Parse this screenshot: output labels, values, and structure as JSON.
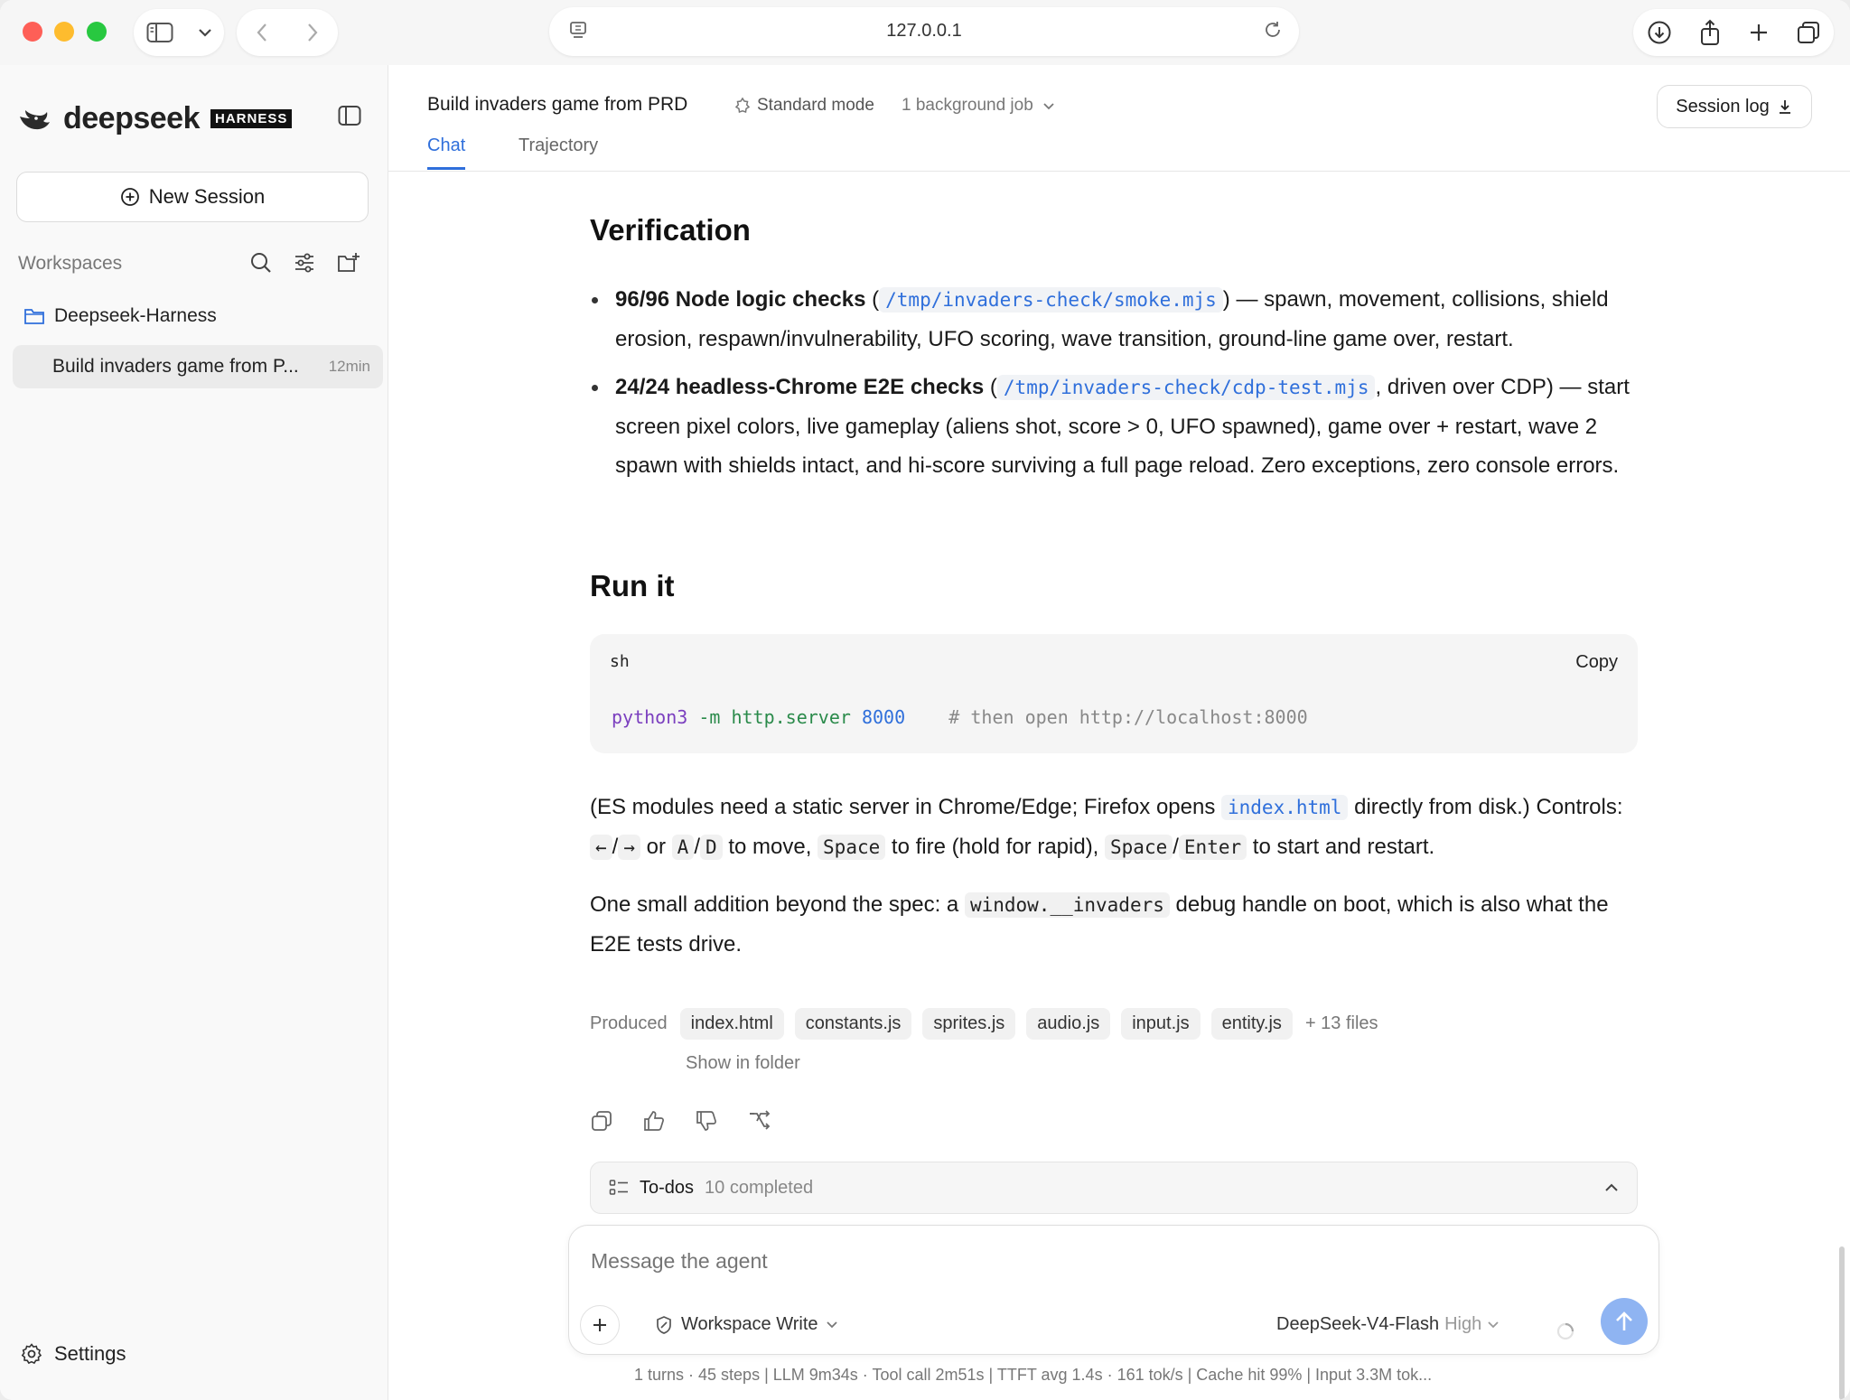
{
  "browser": {
    "url": "127.0.0.1"
  },
  "sidebar": {
    "brand_name": "deepseek",
    "brand_badge": "HARNESS",
    "new_session_label": "New Session",
    "workspaces_label": "Workspaces",
    "workspace_name": "Deepseek-Harness",
    "session_title": "Build invaders game from P...",
    "session_time": "12min",
    "settings_label": "Settings"
  },
  "header": {
    "session_name": "Build invaders game from PRD",
    "mode": "Standard mode",
    "background_jobs": "1 background job",
    "session_log_label": "Session log",
    "tabs": [
      {
        "label": "Chat",
        "active": true
      },
      {
        "label": "Trajectory",
        "active": false
      }
    ]
  },
  "content": {
    "verification_heading": "Verification",
    "bullet1": {
      "bold": "96/96 Node logic checks",
      "open": " (",
      "code": "/tmp/invaders-check/smoke.mjs",
      "rest": ") — spawn, movement, collisions, shield erosion, respawn/invulnerability, UFO scoring, wave transition, ground-line game over, restart."
    },
    "bullet2": {
      "bold": "24/24 headless-Chrome E2E checks",
      "open": " (",
      "code": "/tmp/invaders-check/cdp-test.mjs",
      "rest": ", driven over CDP) — start screen pixel colors, live gameplay (aliens shot, score > 0, UFO spawned), game over + restart, wave 2 spawn with shields intact, and hi-score surviving a full page reload. Zero exceptions, zero console errors."
    },
    "run_heading": "Run it",
    "code_block": {
      "lang": "sh",
      "copy_label": "Copy",
      "cmd": "python3",
      "flag": " -m http.server",
      "num": " 8000",
      "comment": "    # then open http://localhost:8000"
    },
    "para1": {
      "t1": "(ES modules need a static server in Chrome/Edge; Firefox opens ",
      "c1": "index.html",
      "t2": " directly from disk.) Controls: ",
      "k1": "←",
      "s1": "/",
      "k2": "→",
      "t3": " or ",
      "k3": "A",
      "s2": "/",
      "k4": "D",
      "t4": " to move, ",
      "k5": "Space",
      "t5": " to fire (hold for rapid), ",
      "k6": "Space",
      "s3": "/",
      "k7": "Enter",
      "t6": " to start and restart."
    },
    "para2": {
      "t1": "One small addition beyond the spec: a ",
      "c1": "window.__invaders",
      "t2": " debug handle on boot, which is also what the E2E tests drive."
    },
    "produced_label": "Produced",
    "files": [
      "index.html",
      "constants.js",
      "sprites.js",
      "audio.js",
      "input.js",
      "entity.js"
    ],
    "more_files": "+ 13 files",
    "show_in_folder": "Show in folder",
    "todos_label": "To-dos",
    "todos_count": "10 completed"
  },
  "composer": {
    "placeholder": "Message the agent",
    "permission": "Workspace Write",
    "model": "DeepSeek-V4-Flash",
    "model_level": "High"
  },
  "stats": "1 turns · 45 steps   |   LLM 9m34s · Tool call 2m51s   |   TTFT avg 1.4s · 161 tok/s   |   Cache hit 99%   |   Input 3.3M tok...",
  "colors": {
    "accent": "#2f6fdb",
    "send_button": "#8fb4f2"
  }
}
